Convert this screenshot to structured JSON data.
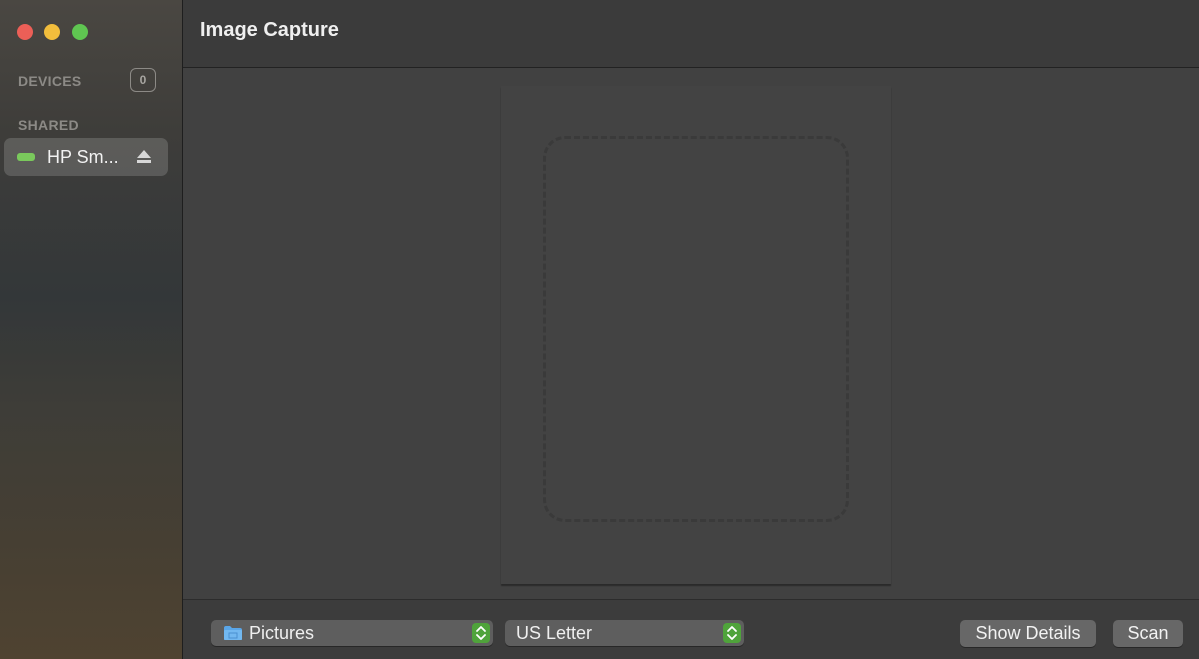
{
  "window": {
    "title": "Image Capture"
  },
  "sidebar": {
    "devices_label": "DEVICES",
    "devices_count": "0",
    "shared_label": "SHARED",
    "shared_devices": [
      {
        "name": "HP Sm...",
        "icon": "printer-icon",
        "status_color": "#7ac95c"
      }
    ]
  },
  "toolbar": {
    "destination": {
      "value": "Pictures",
      "icon": "folder-icon"
    },
    "paper_size": {
      "value": "US Letter"
    },
    "show_details_label": "Show Details",
    "scan_label": "Scan"
  },
  "colors": {
    "accent": "#4fa33b",
    "close": "#ec5f57",
    "minimize": "#f2bd3c",
    "maximize": "#5fc651"
  }
}
